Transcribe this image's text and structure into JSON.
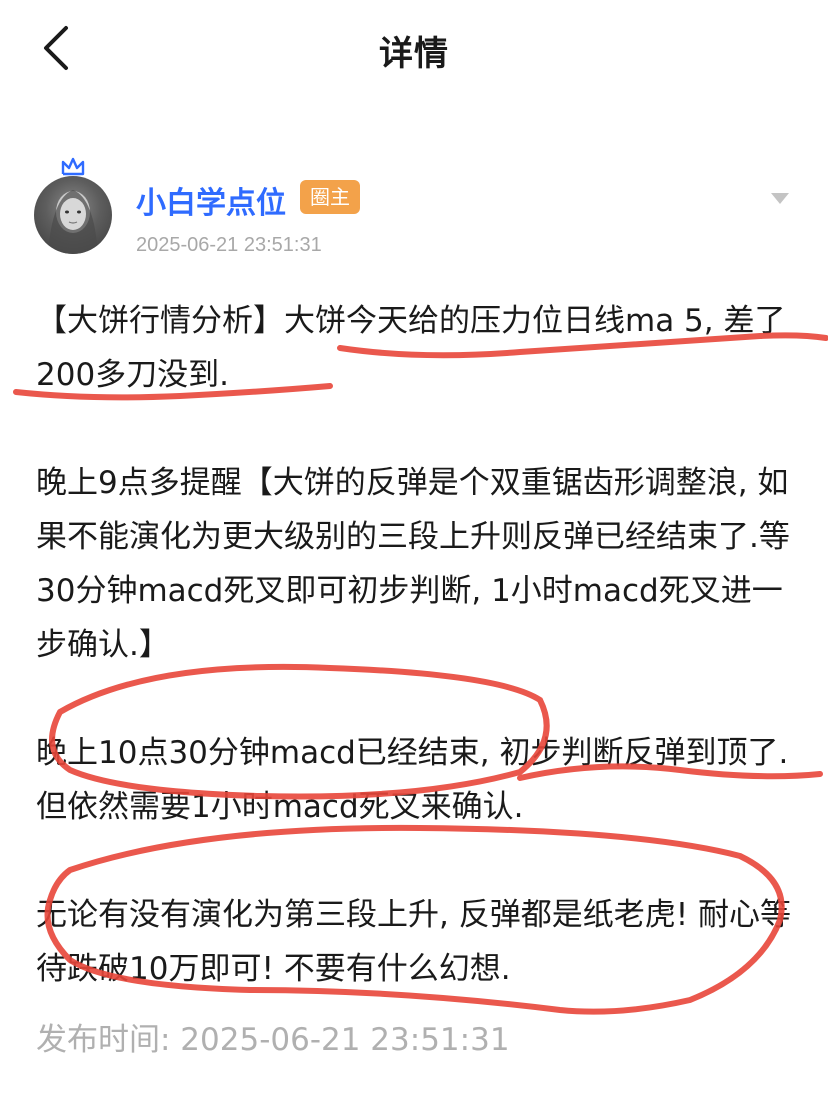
{
  "nav": {
    "title": "详情",
    "back_icon": "chevron-left-icon"
  },
  "author": {
    "name": "小白学点位",
    "badge": "圈主",
    "time": "2025-06-21 23:51:31",
    "crown_icon": "crown-icon",
    "more_icon": "caret-down-icon"
  },
  "post": {
    "paragraphs": [
      "【大饼行情分析】大饼今天给的压力位日线ma 5, 差了200多刀没到.",
      "晚上9点多提醒【大饼的反弹是个双重锯齿形调整浪, 如果不能演化为更大级别的三段上升则反弹已经结束了.等30分钟macd死叉即可初步判断, 1小时macd死叉进一步确认.】",
      "晚上10点30分钟macd已经结束, 初步判断反弹到顶了.但依然需要1小时macd死叉来确认.",
      "无论有没有演化为第三段上升, 反弹都是纸老虎! 耐心等待跌破10万即可! 不要有什么幻想."
    ]
  },
  "footer": {
    "publish_label": "发布时间: 2025-06-21 23:51:31"
  },
  "colors": {
    "accent": "#2f6bff",
    "badge": "#f3a24a",
    "annotation": "#e8463a",
    "muted": "#a8a8a8"
  }
}
